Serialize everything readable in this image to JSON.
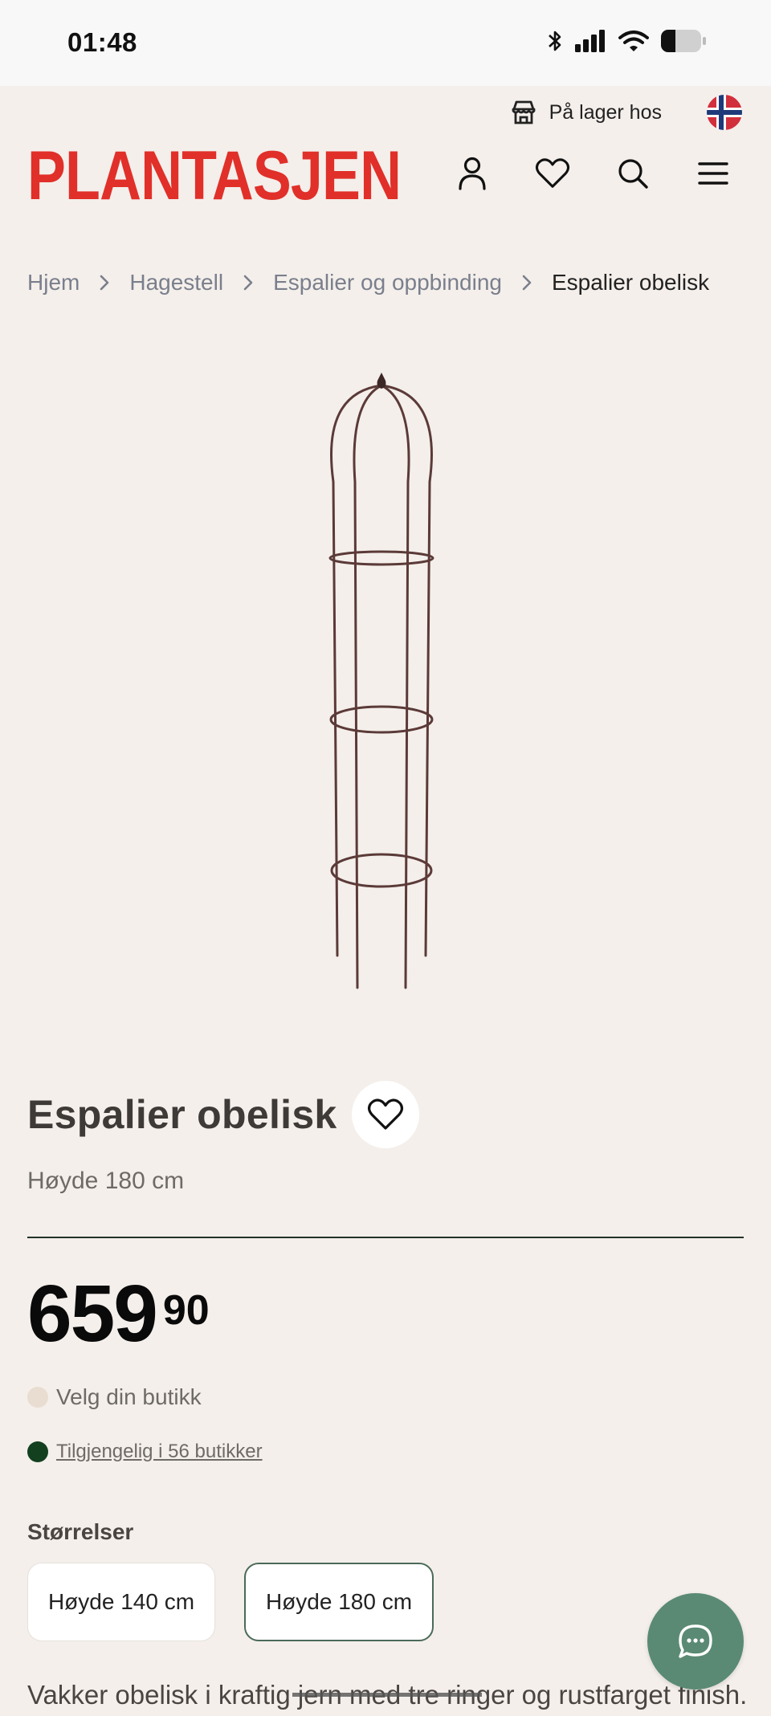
{
  "status_bar": {
    "time": "01:48"
  },
  "header": {
    "store_label": "På lager hos",
    "logo_text": "PLANTASJEN",
    "icons": [
      "user-icon",
      "heart-icon",
      "search-icon",
      "menu-icon"
    ]
  },
  "breadcrumb": {
    "items": [
      "Hjem",
      "Hagestell",
      "Espalier og oppbinding",
      "Espalier obelisk"
    ]
  },
  "product": {
    "title": "Espalier obelisk",
    "subtitle": "Høyde 180 cm",
    "price_main": "659",
    "price_decimals": "90",
    "store_select": "Velg din butikk",
    "availability": "Tilgjengelig i 56 butikker",
    "sizes_label": "Størrelser",
    "sizes": [
      "Høyde 140 cm",
      "Høyde 180 cm"
    ],
    "selected_size": "Høyde 180 cm",
    "description": "Vakker obelisk i kraftig jern med tre ringer og rustfarget finish."
  },
  "colors": {
    "brand": "#e03029",
    "background": "#f4efeb",
    "chat_button": "#5a8a73",
    "available_dot": "#13401f"
  }
}
